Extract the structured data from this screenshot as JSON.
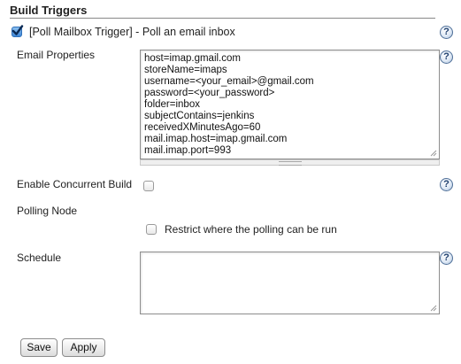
{
  "section": {
    "title": "Build Triggers"
  },
  "trigger": {
    "checked": true,
    "label": "[Poll Mailbox Trigger] - Poll an email inbox"
  },
  "email_properties": {
    "label": "Email Properties",
    "lines": [
      "host=imap.gmail.com",
      "storeName=imaps",
      "username=<your_email>@gmail.com",
      "password=<your_password>",
      "folder=inbox",
      "subjectContains=jenkins",
      "receivedXMinutesAgo=60",
      "mail.imap.host=imap.gmail.com",
      "mail.imap.port=993"
    ]
  },
  "concurrent": {
    "label": "Enable Concurrent Build",
    "checked": false
  },
  "polling_node": {
    "label": "Polling Node",
    "restrict_label": "Restrict where the polling can be run",
    "restrict_checked": false
  },
  "schedule": {
    "label": "Schedule",
    "value": ""
  },
  "buttons": {
    "save": "Save",
    "apply": "Apply"
  },
  "help_icon_glyph": "?",
  "colors": {
    "checkbox_checked": "#3d86d6",
    "help_icon": "#1e3f6e"
  }
}
